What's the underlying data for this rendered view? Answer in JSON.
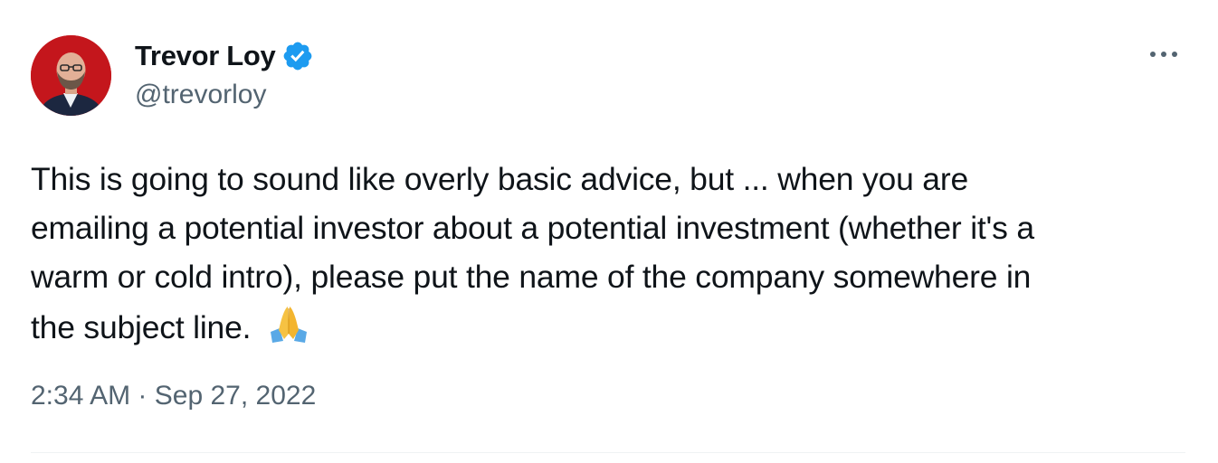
{
  "tweet": {
    "author": {
      "display_name": "Trevor Loy",
      "handle": "@trevorloy",
      "verified": true,
      "avatar_icon": "profile-photo"
    },
    "body_lines": [
      "This is going to sound like overly basic advice, but ... when you are",
      "emailing a potential investor about a potential investment (whether it's a",
      "warm or cold intro), please put the name of the company somewhere in",
      "the subject line."
    ],
    "emoji": "🙏",
    "time": "2:34 AM",
    "separator": "·",
    "date": "Sep 27, 2022"
  },
  "icons": {
    "verified": "verified-badge-icon",
    "more": "more-options-icon",
    "emoji": "folded-hands-icon"
  },
  "colors": {
    "text": "#0f1419",
    "secondary": "#536471",
    "verified_blue": "#1d9bf0",
    "avatar_bg": "#c4161c",
    "divider": "#eff3f4"
  }
}
